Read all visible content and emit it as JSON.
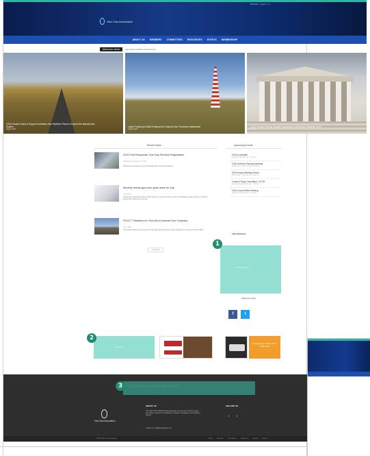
{
  "header": {
    "top_links": "Member Login  |  f  t",
    "logo_text": "Ohio Gas Association"
  },
  "nav": {
    "items": [
      "ABOUT US",
      "MEMBERS",
      "COMMITTEES",
      "RESOURCES",
      "EVENTS",
      "MEMBERSHIP"
    ]
  },
  "ticker": {
    "badge": "BREAKING NEWS",
    "text": "New Gas Headlines & Resources"
  },
  "hero": {
    "slides": [
      {
        "caption": "OGA's Board Votes to Support Northeast Gas Pipeline; Plans to Expand the Natural Gas System",
        "date": "August 2017"
      },
      {
        "caption": "Latest Fracking is Well-Positioned for Natural Gas Producers Nationwide",
        "date": "August 2017"
      },
      {
        "caption": "Ohio's Energy Decision Awaits Consideration Before the Supreme Court",
        "date": "July 2017"
      }
    ]
  },
  "sections": {
    "recent_news": "Recent News",
    "upcoming_events": "Upcoming Events",
    "view_all": "View All Events",
    "load_more": "Load More",
    "follow_us": "Follow the OGA"
  },
  "news": [
    {
      "title": "2019 First Responder One-Day Seminar Registration",
      "date": "Published on August 12, 2019",
      "excerpt": "Click here to register for the First Responder One-Day Seminar."
    },
    {
      "title": "Monthly natural gas price goes down for July",
      "date": "July 2019",
      "excerpt": "Natural gas customers across Ohio will see a lower price this month as wholesale prices continue to decline across the market this summer."
    },
    {
      "title": "PUCO 7 Retailers for Ohio Direct Natural Gas Company",
      "date": "June 2019",
      "excerpt": "The Public Utilities Commission of Ohio has approved seven retail suppliers for customers of the utility."
    }
  ],
  "events": [
    {
      "title": "OGA Committee",
      "date": "August 27 @ 9:00 am - 2:00 pm"
    },
    {
      "title": "OGA Seminar Planning Meeting",
      "date": "September 11 @ 10:00 am - 3:00 pm"
    },
    {
      "title": "2019 Annual Meeting Dinner",
      "date": "September 17 @ 5:00 pm - 9:00 pm"
    },
    {
      "title": "Codes & Regs Committee / OGTA",
      "date": "September 19 @ 9:00 am - 2:00 pm"
    },
    {
      "title": "OGA Council Sites Meeting",
      "date": "October 2 @ 10:00 am - 2:00 pm"
    }
  ],
  "ads": {
    "ad1_text": "Advertise Here",
    "ad2_text": "Sponsor",
    "ad3_text": "Expand your market reach!",
    "ad_c_text": "Coming Soon Meter 1-877-OHIO-GAS"
  },
  "markers": [
    "1",
    "2",
    "3"
  ],
  "footer": {
    "logo_text": "Ohio Gas Association",
    "about_title": "ABOUT US",
    "about_text": "The OHIO GAS ASSOCIATION represents the interests of Ohio's natural gas utilities, marketers and affiliated companies in legislative and regulatory matters.",
    "contact": "Contact us: info@ohiogasassoc.org",
    "follow_title": "FOLLOW US",
    "copyright": "© 2019 Ohio Gas Association",
    "links": [
      "About",
      "Members",
      "Committees",
      "Resources",
      "Events",
      "Contact"
    ]
  },
  "colors": {
    "header_dark": "#0a1c4d",
    "nav_blue": "#1c4fb0",
    "accent_teal": "#27b7a3",
    "highlight": "#3ac4ab",
    "marker": "#1f8c73",
    "footer": "#2e2e2e"
  }
}
